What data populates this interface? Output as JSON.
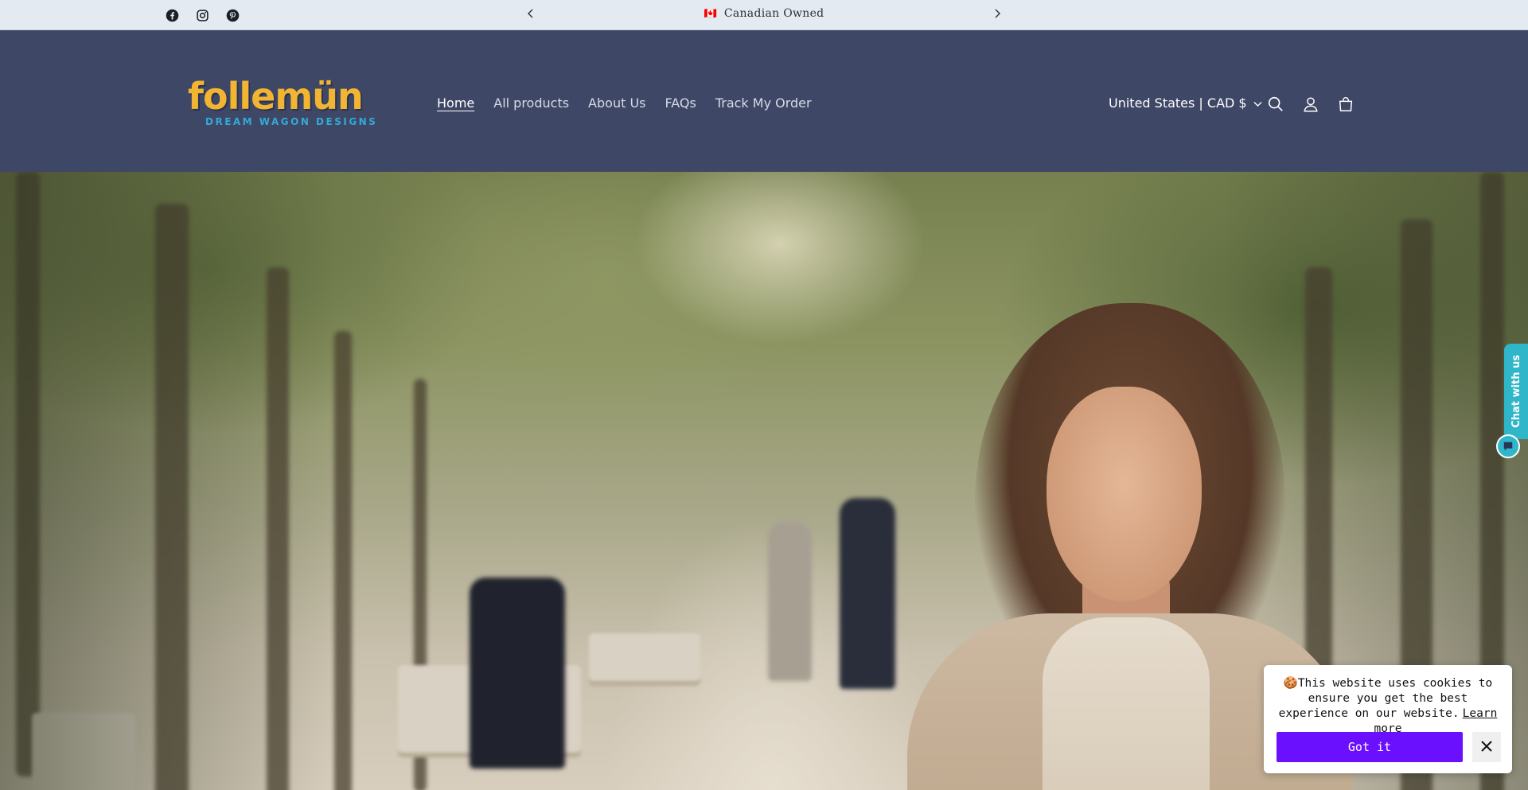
{
  "announcement": {
    "flag": "🇨🇦",
    "text": "Canadian Owned",
    "prev_icon": "chevron-left-icon",
    "next_icon": "chevron-right-icon"
  },
  "social": [
    "facebook-icon",
    "instagram-icon",
    "pinterest-icon"
  ],
  "header": {
    "logo_text": "follemün",
    "logo_subtitle": "DREAM WAGON DESIGNS",
    "nav": [
      {
        "label": "Home",
        "active": true
      },
      {
        "label": "All products",
        "active": false
      },
      {
        "label": "About Us",
        "active": false
      },
      {
        "label": "FAQs",
        "active": false
      },
      {
        "label": "Track My Order",
        "active": false
      }
    ],
    "country_selector": "United States | CAD $",
    "icons": [
      "search-icon",
      "account-icon",
      "cart-icon"
    ]
  },
  "hero": {
    "image": "woman-in-beige-coat-on-tree-lined-path"
  },
  "chat": {
    "label": "Chat with us"
  },
  "cookie": {
    "emoji": "🍪",
    "message": "This website uses cookies to ensure you get the best experience on our website.",
    "learn_more": "Learn more",
    "accept": "Got it"
  },
  "colors": {
    "announcement_bg": "#e4eaf1",
    "header_bg": "#3f4766",
    "logo_yellow": "#f2b531",
    "logo_blue": "#33a9d6",
    "chat_teal": "#2fb7c9",
    "cookie_button": "#6a10ff"
  }
}
